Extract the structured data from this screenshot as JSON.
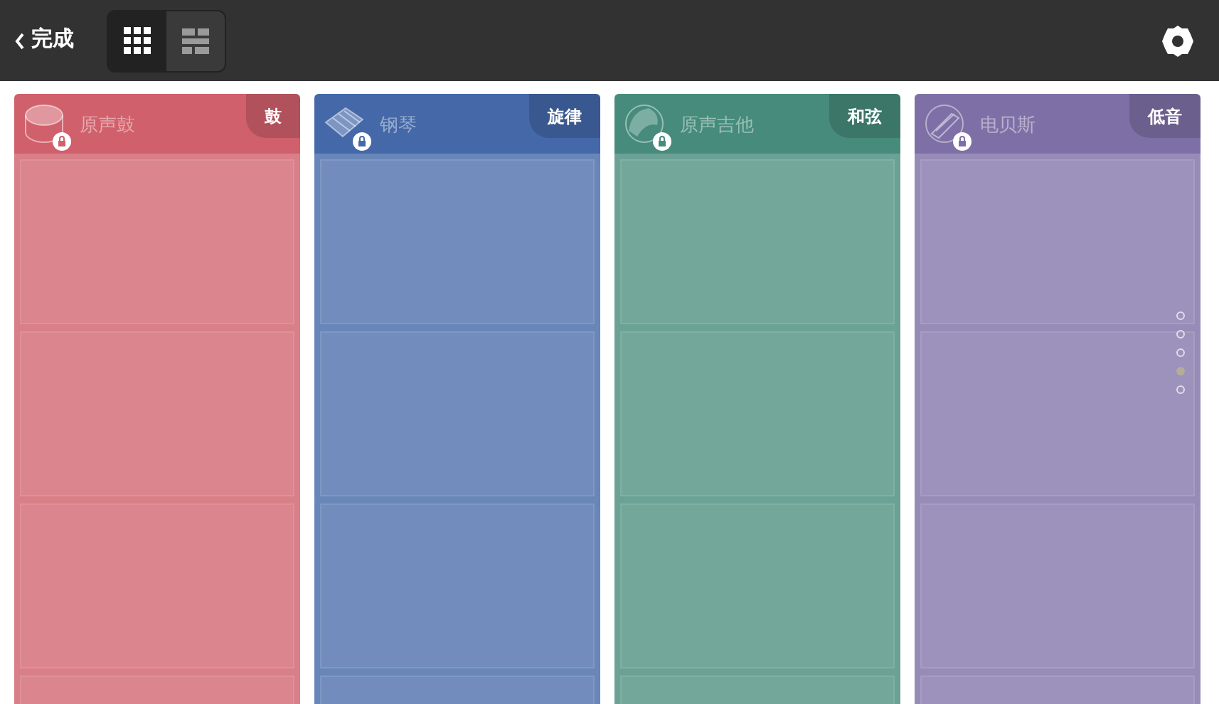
{
  "toolbar": {
    "back_label": "完成",
    "view_modes": [
      {
        "kind": "grid",
        "selected": true
      },
      {
        "kind": "blocks",
        "selected": false
      }
    ]
  },
  "instruments": [
    {
      "name": "原声鼓",
      "category": "鼓",
      "kind": "drum",
      "color": "#d0606b",
      "locked": true
    },
    {
      "name": "钢琴",
      "category": "旋律",
      "kind": "piano",
      "color": "#4468a8",
      "locked": true
    },
    {
      "name": "原声吉他",
      "category": "和弦",
      "kind": "guitar",
      "color": "#468b7b",
      "locked": true
    },
    {
      "name": "电贝斯",
      "category": "低音",
      "kind": "bass",
      "color": "#7e70a6",
      "locked": true
    }
  ],
  "page_dots": [
    {
      "selected": false
    },
    {
      "selected": false
    },
    {
      "selected": false
    },
    {
      "selected": true
    },
    {
      "selected": false
    }
  ]
}
